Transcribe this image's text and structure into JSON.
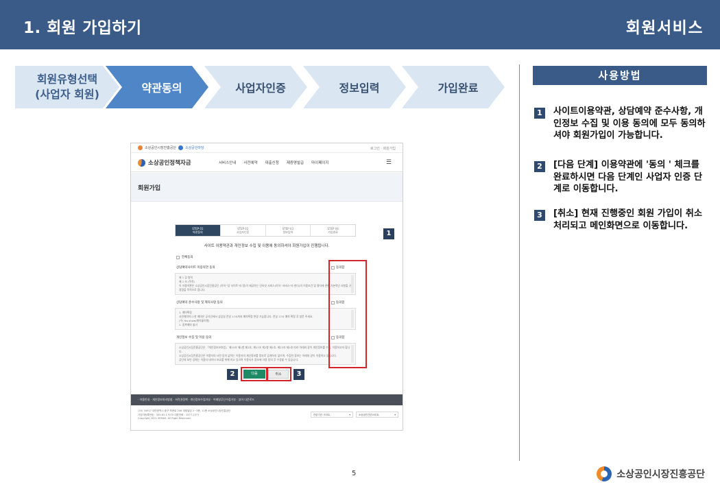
{
  "header": {
    "title": "1. 회원 가입하기",
    "section": "회원서비스"
  },
  "steps": [
    {
      "label": "회원유형선택\n(사업자 회원)",
      "state": "done"
    },
    {
      "label": "약관동의",
      "state": "active"
    },
    {
      "label": "사업자인증",
      "state": "pending"
    },
    {
      "label": "정보입력",
      "state": "pending"
    },
    {
      "label": "가입완료",
      "state": "pending"
    }
  ],
  "help": {
    "title": "사용방법",
    "items": [
      {
        "num": "1",
        "text": "사이트이용약관, 상담예약 준수사항, 개인정보 수집 및 이용 동의에 모두 동의하셔야 회원가입이 가능합니다."
      },
      {
        "num": "2",
        "text": "[다음 단계] 이용약관에 '동의 ' 체크를 완료하시면 다음 단계인 사업자 인증 단계로 이동합니다."
      },
      {
        "num": "3",
        "text": "[취소] 현재 진행중인 회원 가입이 취소 처리되고 메인화면으로 이동합니다."
      }
    ]
  },
  "shot": {
    "top_logos": [
      "소상공인시장진흥공단",
      "소상공인마당"
    ],
    "top_links": "로그인 · 회원가입",
    "brand": "소상공인정책자금",
    "menu": [
      "서비스안내",
      "사전예약",
      "대출신청",
      "제증명발급",
      "마이페이지"
    ],
    "page_title": "회원가입",
    "steps": [
      {
        "no": "STEP 01",
        "label": "약관동의"
      },
      {
        "no": "STEP 02",
        "label": "사업자인증"
      },
      {
        "no": "STEP 03",
        "label": "정보입력"
      },
      {
        "no": "STEP 04",
        "label": "가입완료"
      }
    ],
    "guide": "사이트 이용약관과 개인정보 수집 및 이용에 동의하셔야 회원가입이 진행됩니다.",
    "agree_all": "전체동의",
    "sections": [
      {
        "label": "상담예약사이트 이용약관 동의",
        "agree": "동의함",
        "body": "제 1 장 총칙\n제 1 조 (목적)\n이 이용약관은 소상공인시장진흥공단 (이하 \"당 사이트\"라 함)이 제공하는 인터넷 서비스(이하 \"서비스\"라 한다)의 이용조건 및 절차에 관한 기본적인 사항을 규정함을 목적으로 합니다."
      },
      {
        "label": "상담예약 준수사항 및 제약사항 동의",
        "agree": "동의함",
        "body": "1. 예약확정\n사전예약이나 한 예약은 공식인에서 상담일 전일 17시까지 예약확정 변경 가능합니다. 전일 17시 예약 확정 후 방문 주세요.\n(수) No-show(예약불이행)\n2. 중복예약 불가"
      },
      {
        "label": "개인정보 수집 및 이용 동의",
        "agree": "동의함",
        "body": "소상공인시장진흥공단은 「개인정보보호법」 제15조 제1항 제1호, 제17조 제1항 제1호, 제23조 제1호 따라 아래와 같이 개인정보를 수집, 이용하고자 합니다.\n소상공인시장진흥공단은 이용자의 사전 동의 없이는 이용자의 개인정보를 함부로 공개하지 않으며, 수집된 정보는 아래와 같이 이용하고 있습니다.\n공단의 보안 강화는 이용자 데이터 보호를 위해 하고 있으며 이용자가 정보에 이용 동의 후 수정할 수 있습니다."
      }
    ],
    "badges": [
      "1",
      "2",
      "3"
    ],
    "btn_next": "다음",
    "btn_cancel": "취소",
    "footer_links": "· 이용안내  · 개인정보처리방침  · 저작권정책  · 개인정보수집거부  · 이메일무단수집거부  · 뷰어 다운로드",
    "address": "(35) 34917 대전광역시 중구 보문로 246 대림빌딩 2~3층, 11층 소상공인시장진흥공단\n사업자등록번호 : 305-82-17075 대표전화 : 1577-1577\nCopyright 2021 SEMAS. All Right Reserved.",
    "selects": [
      "관련기관 사이트",
      "소상공인관련사이트"
    ]
  },
  "page_number": "5",
  "footer_org": "소상공인시장진흥공단"
}
